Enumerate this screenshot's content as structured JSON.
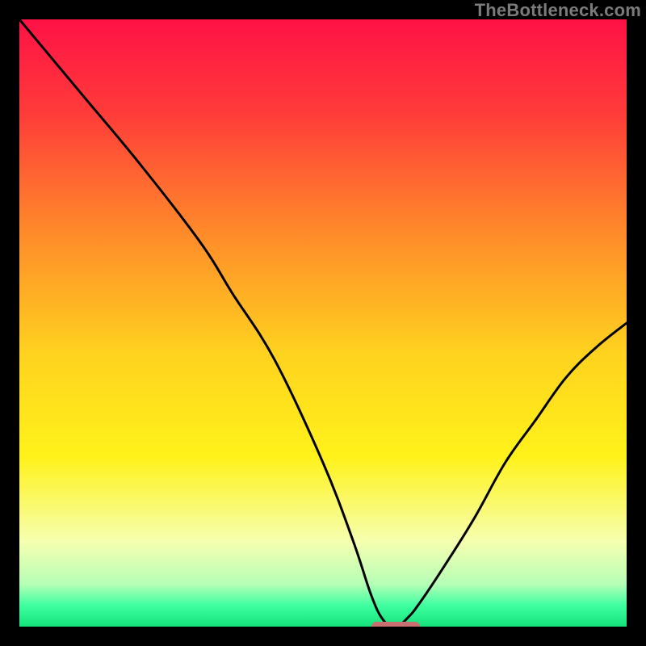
{
  "watermark": "TheBottleneck.com",
  "chart_data": {
    "type": "line",
    "title": "",
    "xlabel": "",
    "ylabel": "",
    "xlim": [
      0,
      100
    ],
    "ylim": [
      0,
      100
    ],
    "grid": false,
    "legend": false,
    "x": [
      0,
      10,
      20,
      30,
      35,
      42,
      50,
      55,
      58,
      60,
      62,
      64,
      66,
      70,
      75,
      80,
      85,
      90,
      95,
      100
    ],
    "values": [
      100,
      88,
      76,
      63,
      55,
      44,
      27,
      14,
      5,
      1,
      0,
      1.5,
      4,
      10,
      18,
      27,
      34,
      41,
      46,
      50
    ],
    "gradient_stops": [
      {
        "pos": 0.0,
        "color": "#ff1246"
      },
      {
        "pos": 0.15,
        "color": "#ff3a3a"
      },
      {
        "pos": 0.35,
        "color": "#ff8a2a"
      },
      {
        "pos": 0.55,
        "color": "#ffd21f"
      },
      {
        "pos": 0.72,
        "color": "#fff21a"
      },
      {
        "pos": 0.86,
        "color": "#f6ffb0"
      },
      {
        "pos": 0.93,
        "color": "#b6ffb6"
      },
      {
        "pos": 0.965,
        "color": "#3fffa1"
      },
      {
        "pos": 1.0,
        "color": "#14e27a"
      }
    ],
    "marker": {
      "x_start": 58,
      "x_end": 66,
      "y": 0,
      "color": "#c86f72"
    }
  }
}
